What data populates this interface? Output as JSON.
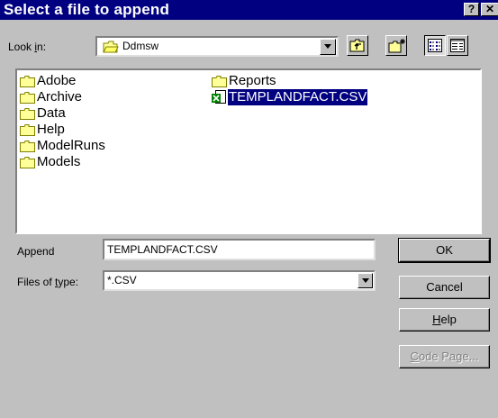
{
  "window": {
    "title": "Select a file to append",
    "help_button": "?",
    "close_button": "✕"
  },
  "look_in": {
    "label_pre": "Look ",
    "label_ul": "i",
    "label_post": "n:",
    "value": "Ddmsw"
  },
  "file_list": {
    "col1": [
      "Adobe",
      "Archive",
      "Data",
      "Help",
      "ModelRuns",
      "Models"
    ],
    "col2": [
      "Reports",
      "TEMPLANDFACT.CSV"
    ]
  },
  "append": {
    "label": "Append",
    "value": "TEMPLANDFACT.CSV"
  },
  "files_of_type": {
    "label_pre": "Files of ",
    "label_ul": "t",
    "label_post": "ype:",
    "value": "*.CSV"
  },
  "buttons": {
    "ok": "OK",
    "cancel": "Cancel",
    "help_ul": "H",
    "help_rest": "elp",
    "codepage_ul": "C",
    "codepage_rest": "ode Page..."
  },
  "colors": {
    "titlebar": "#000080",
    "face": "#c0c0c0",
    "selection": "#000080",
    "folder": "#ffff99"
  }
}
